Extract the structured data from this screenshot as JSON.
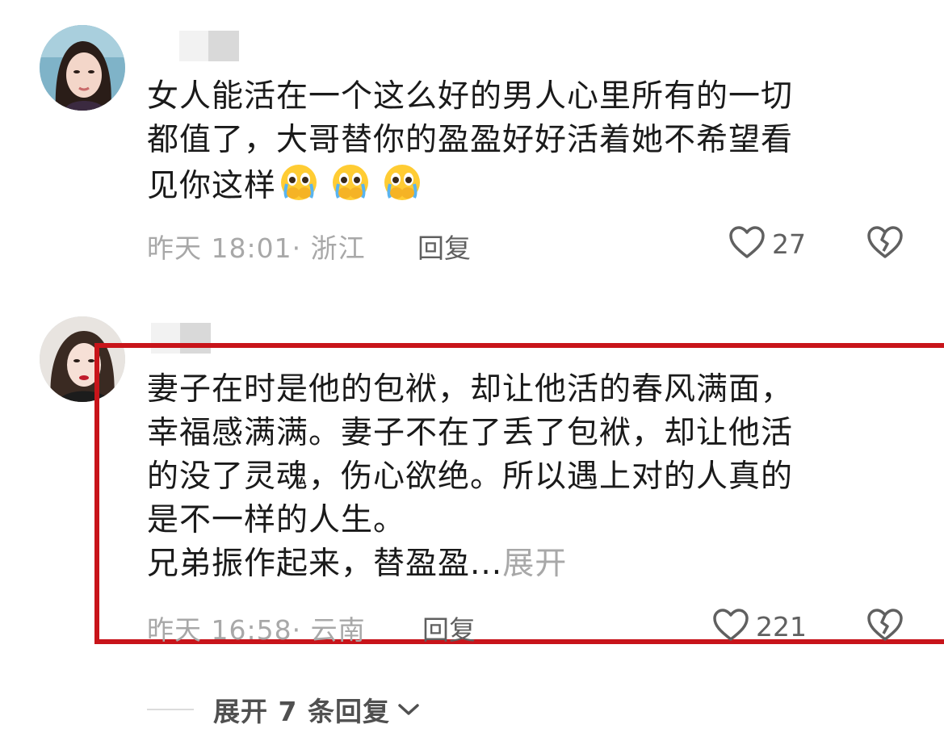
{
  "comments": [
    {
      "text_lines": [
        "女人能活在一个这么好的男人心里所有的一切",
        "都值了，大哥替你的盈盈好好活着她不希望看",
        "见你这样"
      ],
      "emoji": [
        "crying-face-emoji",
        "crying-face-emoji",
        "crying-face-emoji"
      ],
      "meta": "昨天 18:01· 浙江",
      "reply_label": "回复",
      "like_count": "27"
    },
    {
      "text_lines": [
        "妻子在时是他的包袱，却让他活的春风满面，",
        "幸福感满满。妻子不在了丢了包袱，却让他活",
        "的没了灵魂，伤心欲绝。所以遇上对的人真的",
        "是不一样的人生。",
        "兄弟振作起来，替盈盈..."
      ],
      "expand_label": "展开",
      "meta": "昨天 16:58· 云南",
      "reply_label": "回复",
      "like_count": "221"
    }
  ],
  "more_replies": {
    "label": "展开 7 条回复"
  },
  "colors": {
    "highlight": "#c8141a",
    "muted": "#a8a8a8",
    "text": "#1a1a1a"
  },
  "icons": [
    "heart-icon",
    "broken-heart-icon",
    "chevron-down-icon"
  ]
}
